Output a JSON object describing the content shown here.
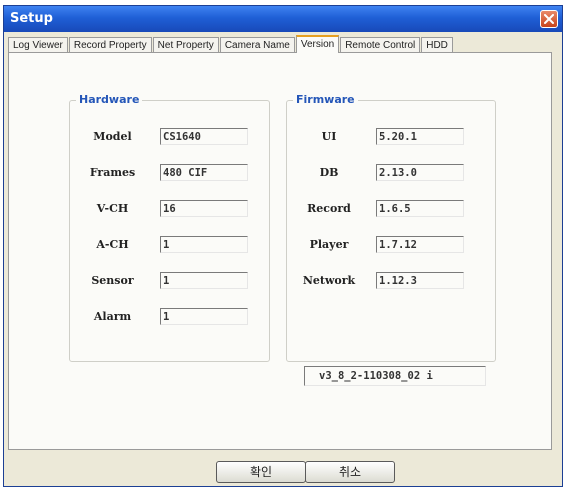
{
  "window": {
    "title": "Setup"
  },
  "tabs": [
    {
      "label": "Log Viewer",
      "active": false
    },
    {
      "label": "Record Property",
      "active": false
    },
    {
      "label": "Net Property",
      "active": false
    },
    {
      "label": "Camera Name",
      "active": false
    },
    {
      "label": "Version",
      "active": true
    },
    {
      "label": "Remote Control",
      "active": false
    },
    {
      "label": "HDD",
      "active": false
    }
  ],
  "hardware": {
    "title": "Hardware",
    "rows": [
      {
        "label": "Model",
        "value": "CS1640"
      },
      {
        "label": "Frames",
        "value": "480 CIF"
      },
      {
        "label": "V-CH",
        "value": "16"
      },
      {
        "label": "A-CH",
        "value": "1"
      },
      {
        "label": "Sensor",
        "value": "1"
      },
      {
        "label": "Alarm",
        "value": "1"
      }
    ]
  },
  "firmware": {
    "title": "Firmware",
    "rows": [
      {
        "label": "UI",
        "value": "5.20.1"
      },
      {
        "label": "DB",
        "value": "2.13.0"
      },
      {
        "label": "Record",
        "value": "1.6.5"
      },
      {
        "label": "Player",
        "value": "1.7.12"
      },
      {
        "label": "Network",
        "value": "1.12.3"
      }
    ],
    "full_version": "v3_8_2-110308_02 i"
  },
  "buttons": {
    "ok": "확인",
    "cancel": "취소"
  },
  "colors": {
    "titlebar": "#1f5fd6",
    "group_title": "#2456b8",
    "active_tab_accent": "#e6a020",
    "close_button": "#c8441c"
  },
  "icons": {
    "close": "close-icon"
  }
}
